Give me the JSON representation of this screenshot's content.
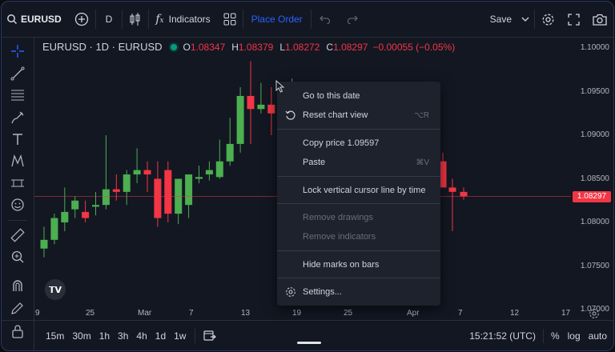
{
  "toolbar": {
    "symbol": "EURUSD",
    "interval": "D",
    "indicators_label": "Indicators",
    "place_order_label": "Place Order",
    "save_label": "Save"
  },
  "legend": {
    "title": "EURUSD · 1D · EURUSD",
    "open_label": "O",
    "open": "1.08347",
    "high_label": "H",
    "high": "1.08379",
    "low_label": "L",
    "low": "1.08272",
    "close_label": "C",
    "close": "1.08297",
    "change": "−0.00055 (−0.05%)"
  },
  "price_axis": {
    "labels": [
      "1.10000",
      "1.09500",
      "1.09000",
      "1.08500",
      "1.08000",
      "1.07500",
      "1.07000"
    ],
    "current_price": "1.08297"
  },
  "time_axis": {
    "labels": [
      "9",
      "25",
      "Mar",
      "7",
      "13",
      "19",
      "25",
      "Apr",
      "7",
      "12",
      "17"
    ]
  },
  "context_menu": {
    "go_to_date": "Go to this date",
    "reset_view": "Reset chart view",
    "reset_shortcut": "⌥R",
    "copy_price": "Copy price 1.09597",
    "paste": "Paste",
    "paste_shortcut": "⌘V",
    "lock_cursor": "Lock vertical cursor line by time",
    "remove_drawings": "Remove drawings",
    "remove_indicators": "Remove indicators",
    "hide_marks": "Hide marks on bars",
    "settings": "Settings..."
  },
  "bottom_bar": {
    "ranges": [
      "15m",
      "30m",
      "1h",
      "3h",
      "4h",
      "1d",
      "1w"
    ],
    "time": "15:21:52 (UTC)",
    "percent": "%",
    "log": "log",
    "auto": "auto"
  },
  "colors": {
    "up": "#4caf50",
    "down": "#f23645",
    "accent": "#2962ff",
    "background": "#131722"
  },
  "chart_data": {
    "type": "candlestick",
    "x": [
      "Feb 8",
      "Feb 9",
      "Feb 12",
      "Feb 13",
      "Feb 14",
      "Feb 15",
      "Feb 16",
      "Feb 19",
      "Feb 20",
      "Feb 21",
      "Feb 22",
      "Feb 23",
      "Feb 26",
      "Feb 27",
      "Feb 28",
      "Feb 29",
      "Mar 1",
      "Mar 4",
      "Mar 5",
      "Mar 6",
      "Mar 7",
      "Mar 8",
      "Mar 11",
      "Mar 12",
      "Mar 13",
      "Mar 14",
      "Mar 15",
      "Apr 4",
      "Apr 5",
      "Apr 8"
    ],
    "open": [
      1.077,
      1.078,
      1.08,
      1.0815,
      1.0812,
      1.0818,
      1.082,
      1.0838,
      1.0835,
      1.0855,
      1.086,
      1.085,
      1.086,
      1.081,
      1.082,
      1.085,
      1.0855,
      1.0852,
      1.087,
      1.089,
      1.0945,
      1.093,
      1.0935,
      1.0925,
      1.0935,
      1.095,
      1.088,
      1.087,
      1.084,
      1.0835
    ],
    "high": [
      1.0795,
      1.081,
      1.084,
      1.083,
      1.0825,
      1.0835,
      1.09,
      1.0855,
      1.086,
      1.0885,
      1.087,
      1.087,
      1.087,
      1.085,
      1.0855,
      1.0865,
      1.087,
      1.0895,
      1.092,
      1.0955,
      1.0985,
      1.096,
      1.0955,
      1.0945,
      1.0965,
      1.096,
      1.089,
      1.088,
      1.085,
      1.084
    ],
    "low": [
      1.076,
      1.0775,
      1.079,
      1.0805,
      1.08,
      1.0808,
      1.0815,
      1.0825,
      1.082,
      1.0845,
      1.0835,
      1.0795,
      1.08,
      1.0798,
      1.0805,
      1.0845,
      1.0848,
      1.085,
      1.0865,
      1.088,
      1.089,
      1.0925,
      1.09,
      1.0915,
      1.0925,
      1.087,
      1.0875,
      1.084,
      1.079,
      1.0826
    ],
    "close": [
      1.078,
      1.0805,
      1.0812,
      1.0825,
      1.0805,
      1.082,
      1.0838,
      1.0835,
      1.0855,
      1.086,
      1.0855,
      1.0805,
      1.081,
      1.085,
      1.0855,
      1.0852,
      1.086,
      1.087,
      1.089,
      1.0945,
      1.093,
      1.0935,
      1.0925,
      1.0935,
      1.095,
      1.088,
      1.0882,
      1.084,
      1.0835,
      1.083
    ],
    "ylim": [
      1.07,
      1.1
    ],
    "grid": false,
    "current_price": 1.08297
  }
}
